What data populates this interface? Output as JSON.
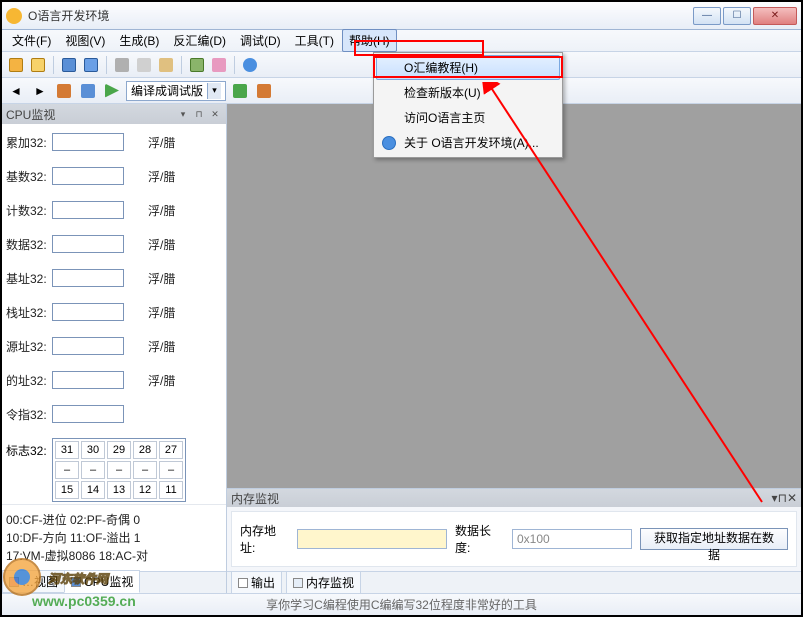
{
  "window": {
    "title": "O语言开发环境"
  },
  "menu": {
    "file": "文件(F)",
    "view": "视图(V)",
    "build": "生成(B)",
    "decompile": "反汇编(D)",
    "debug": "调试(D)",
    "tools": "工具(T)",
    "help": "帮助(H)"
  },
  "dropdown": {
    "tutorial": "O汇编教程(H)",
    "check": "检查新版本(U)",
    "visit": "访问O语言主页",
    "about": "关于 O语言开发环境(A)..."
  },
  "compile_combo": "编译成调试版",
  "cpu_panel": {
    "title": "CPU监视",
    "regs": [
      {
        "label": "累加32:",
        "suffix": "浮/腊"
      },
      {
        "label": "基数32:",
        "suffix": "浮/腊"
      },
      {
        "label": "计数32:",
        "suffix": "浮/腊"
      },
      {
        "label": "数据32:",
        "suffix": "浮/腊"
      },
      {
        "label": "基址32:",
        "suffix": "浮/腊"
      },
      {
        "label": "栈址32:",
        "suffix": "浮/腊"
      },
      {
        "label": "源址32:",
        "suffix": "浮/腊"
      },
      {
        "label": "的址32:",
        "suffix": "浮/腊"
      },
      {
        "label": "令指32:",
        "suffix": ""
      }
    ],
    "flags_label": "标志32:",
    "flags": [
      [
        "31",
        "30",
        "29",
        "28",
        "27"
      ],
      [
        "–",
        "–",
        "–",
        "–",
        "–"
      ],
      [
        "15",
        "14",
        "13",
        "12",
        "11"
      ]
    ],
    "info": [
      "00:CF-进位 02:PF-奇偶 0",
      "10:DF-方向 11:OF-溢出 1",
      "17:VM-虚拟8086 18:AC-对"
    ]
  },
  "bottom_tabs": {
    "view": "…视图",
    "cpu": "CPU监视"
  },
  "mem_panel": {
    "title": "内存监视",
    "addr_label": "内存地址:",
    "len_label": "数据长度:",
    "len_value": "0x100",
    "btn": "获取指定地址数据在数据"
  },
  "main_tabs": {
    "output": "输出",
    "mem": "内存监视"
  },
  "watermark": {
    "text": "河东软件网",
    "url": "www.pc0359.cn"
  },
  "status": "享你学习C编程使用C编编写32位程度非常好的工具"
}
